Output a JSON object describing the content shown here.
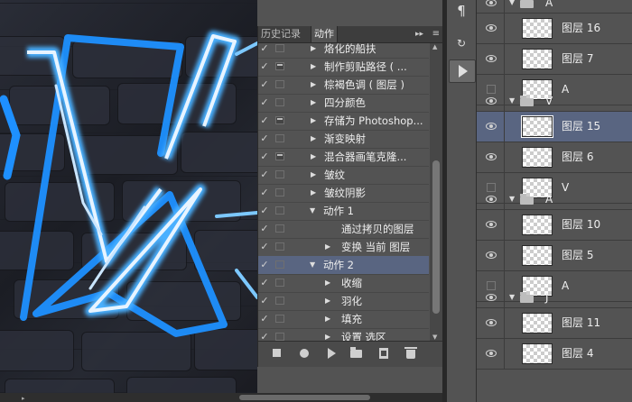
{
  "actions_panel": {
    "tabs": {
      "history": "历史记录",
      "actions": "动作"
    },
    "forward_symbol": "▸▸",
    "menu_symbol": "≡",
    "rows": [
      {
        "label": "烙化的船扶",
        "check": "✓",
        "dialog": false,
        "expand": "▶",
        "level": 1,
        "selected": false
      },
      {
        "label": "制作剪贴路径 ( ...",
        "check": "✓",
        "dialog": true,
        "expand": "▶",
        "level": 1,
        "selected": false
      },
      {
        "label": "棕褐色调 ( 图层 )",
        "check": "✓",
        "dialog": false,
        "expand": "▶",
        "level": 1,
        "selected": false
      },
      {
        "label": "四分颜色",
        "check": "✓",
        "dialog": false,
        "expand": "▶",
        "level": 1,
        "selected": false
      },
      {
        "label": "存储为 Photoshop...",
        "check": "✓",
        "dialog": true,
        "expand": "▶",
        "level": 1,
        "selected": false
      },
      {
        "label": "渐变映射",
        "check": "✓",
        "dialog": false,
        "expand": "▶",
        "level": 1,
        "selected": false
      },
      {
        "label": "混合器画笔克隆...",
        "check": "✓",
        "dialog": true,
        "expand": "▶",
        "level": 1,
        "selected": false
      },
      {
        "label": "皱纹",
        "check": "✓",
        "dialog": false,
        "expand": "▶",
        "level": 1,
        "selected": false
      },
      {
        "label": "皱纹阴影",
        "check": "✓",
        "dialog": false,
        "expand": "▶",
        "level": 1,
        "selected": false
      },
      {
        "label": "动作 1",
        "check": "✓",
        "dialog": false,
        "expand": "▼",
        "level": 0,
        "selected": false
      },
      {
        "label": "通过拷贝的图层",
        "check": "✓",
        "dialog": false,
        "expand": "",
        "level": 2,
        "selected": false
      },
      {
        "label": "变换 当前 图层",
        "check": "✓",
        "dialog": false,
        "expand": "▶",
        "level": 2,
        "selected": false
      },
      {
        "label": "动作 2",
        "check": "✓",
        "dialog": false,
        "expand": "▼",
        "level": 0,
        "selected": true
      },
      {
        "label": "收缩",
        "check": "✓",
        "dialog": false,
        "expand": "▶",
        "level": 2,
        "selected": false
      },
      {
        "label": "羽化",
        "check": "✓",
        "dialog": false,
        "expand": "▶",
        "level": 2,
        "selected": false
      },
      {
        "label": "填充",
        "check": "✓",
        "dialog": false,
        "expand": "▶",
        "level": 2,
        "selected": false
      },
      {
        "label": "设置 选区",
        "check": "✓",
        "dialog": false,
        "expand": "▶",
        "level": 2,
        "selected": false
      }
    ]
  },
  "dock": {
    "paragraph_symbol": "¶",
    "actions_symbol": "↻"
  },
  "layers": [
    {
      "type": "group",
      "name": "A",
      "visible": true,
      "expanded": true,
      "selected": false
    },
    {
      "type": "layer",
      "name": "图层 16",
      "visible": true,
      "selected": false
    },
    {
      "type": "layer",
      "name": "图层 7",
      "visible": true,
      "selected": false
    },
    {
      "type": "layer",
      "name": "A",
      "visible": false,
      "selected": false
    },
    {
      "type": "group",
      "name": "V",
      "visible": true,
      "expanded": true,
      "selected": false
    },
    {
      "type": "layer",
      "name": "图层 15",
      "visible": true,
      "selected": true
    },
    {
      "type": "layer",
      "name": "图层 6",
      "visible": true,
      "selected": false
    },
    {
      "type": "layer",
      "name": "V",
      "visible": false,
      "selected": false
    },
    {
      "type": "group",
      "name": "A",
      "visible": true,
      "expanded": true,
      "selected": false
    },
    {
      "type": "layer",
      "name": "图层 10",
      "visible": true,
      "selected": false
    },
    {
      "type": "layer",
      "name": "图层 5",
      "visible": true,
      "selected": false
    },
    {
      "type": "layer",
      "name": "A",
      "visible": false,
      "selected": false
    },
    {
      "type": "group",
      "name": "J",
      "visible": true,
      "expanded": true,
      "selected": false
    },
    {
      "type": "layer",
      "name": "图层 11",
      "visible": true,
      "selected": false
    },
    {
      "type": "layer",
      "name": "图层 4",
      "visible": true,
      "selected": false
    }
  ],
  "colors": {
    "neon_blue": "#1e90ff",
    "neon_core": "#e8f4ff",
    "selection": "#596581"
  }
}
